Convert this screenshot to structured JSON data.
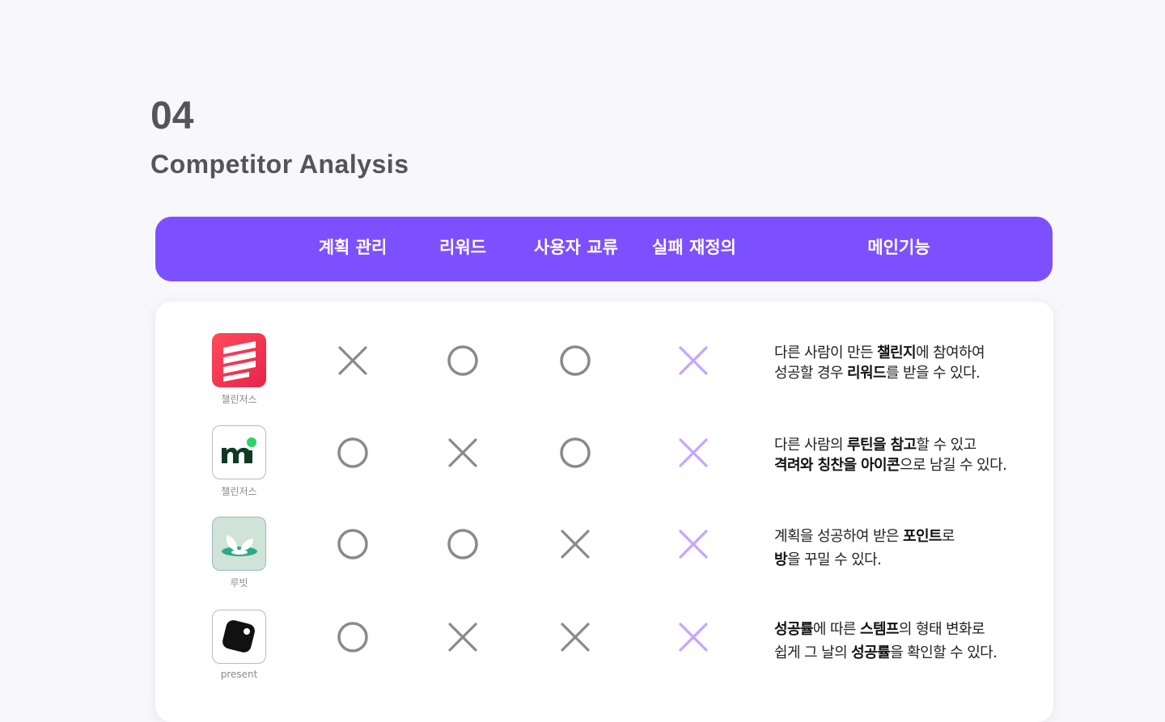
{
  "section": {
    "number": "04",
    "title": "Competitor Analysis"
  },
  "columns": [
    "계획 관리",
    "리워드",
    "사용자 교류",
    "실패 재정의",
    "메인기능"
  ],
  "colors": {
    "accent": "#7d50ff",
    "mark_gray": "#8a8a8a",
    "mark_purple": "#c6a4ff"
  },
  "rows": [
    {
      "app": {
        "name": "챌린저스",
        "icon": "challengers-stripes-icon"
      },
      "marks": [
        "x",
        "o",
        "o",
        "x"
      ],
      "desc": [
        [
          {
            "t": "다른 사람이 만든 ",
            "b": false
          },
          {
            "t": "챌린지",
            "b": true
          },
          {
            "t": "에 참여하여",
            "b": false
          }
        ],
        [
          {
            "t": "성공할 경우 ",
            "b": false
          },
          {
            "t": "리워드",
            "b": true
          },
          {
            "t": "를 받을 수 있다.",
            "b": false
          }
        ]
      ]
    },
    {
      "app": {
        "name": "챌린저스",
        "icon": "mi-logo-icon"
      },
      "marks": [
        "o",
        "x",
        "o",
        "x"
      ],
      "desc": [
        [
          {
            "t": "다른 사람의 ",
            "b": false
          },
          {
            "t": "루틴을 참고",
            "b": true
          },
          {
            "t": "할 수 있고",
            "b": false
          }
        ],
        [
          {
            "t": "격려와 칭찬을 아이콘",
            "b": true
          },
          {
            "t": "으로 남길 수 있다.",
            "b": false
          }
        ]
      ]
    },
    {
      "app": {
        "name": "루빗",
        "icon": "rubit-sprout-icon"
      },
      "marks": [
        "o",
        "o",
        "x",
        "x"
      ],
      "desc": [
        [
          {
            "t": "계획을 성공하여 받은 ",
            "b": false
          },
          {
            "t": "포인트",
            "b": true
          },
          {
            "t": "로",
            "b": false
          }
        ],
        [
          {
            "t": "방",
            "b": true
          },
          {
            "t": "을 꾸밀 수 있다.",
            "b": false
          }
        ]
      ]
    },
    {
      "app": {
        "name": "present",
        "icon": "present-rounded-square-icon"
      },
      "marks": [
        "o",
        "x",
        "x",
        "x"
      ],
      "desc": [
        [
          {
            "t": "성공률",
            "b": true
          },
          {
            "t": "에 따른 ",
            "b": false
          },
          {
            "t": "스템프",
            "b": true
          },
          {
            "t": "의 형태 변화로",
            "b": false
          }
        ],
        [
          {
            "t": "쉽게 그 날의 ",
            "b": false
          },
          {
            "t": "성공률",
            "b": true
          },
          {
            "t": "을 확인할 수 있다.",
            "b": false
          }
        ]
      ]
    }
  ]
}
